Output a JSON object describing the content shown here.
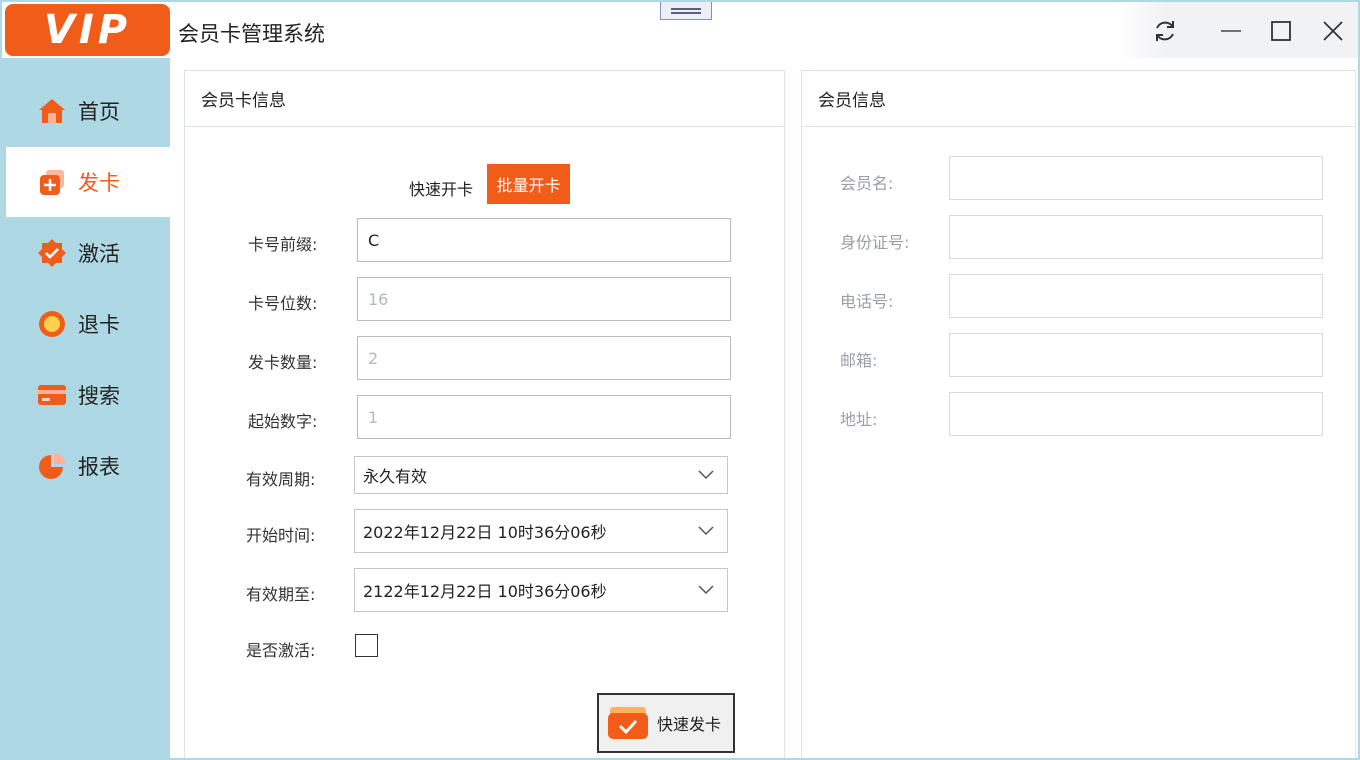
{
  "logo_text": "VIP",
  "app_title": "会员卡管理系统",
  "window_controls": {
    "refresh_icon": "refresh-icon",
    "minimize_icon": "minimize-icon",
    "maximize_icon": "maximize-icon",
    "close_icon": "close-icon"
  },
  "sidebar": {
    "items": [
      {
        "label": "首页",
        "icon": "home-icon"
      },
      {
        "label": "发卡",
        "icon": "add-card-icon",
        "active": true
      },
      {
        "label": "激活",
        "icon": "check-badge-icon"
      },
      {
        "label": "退卡",
        "icon": "return-icon"
      },
      {
        "label": "搜索",
        "icon": "card-search-icon"
      },
      {
        "label": "报表",
        "icon": "pie-chart-icon"
      }
    ]
  },
  "card_panel": {
    "title": "会员卡信息",
    "tabs": {
      "quick": "快速开卡",
      "batch": "批量开卡"
    },
    "fields": {
      "prefix_label": "卡号前缀:",
      "prefix_value": "C",
      "digits_label": "卡号位数:",
      "digits_placeholder": "16",
      "count_label": "发卡数量:",
      "count_placeholder": "2",
      "start_label": "起始数字:",
      "start_placeholder": "1",
      "period_label": "有效周期:",
      "period_value": "永久有效",
      "start_time_label": "开始时间:",
      "start_time_value": "2022年12月22日 10时36分06秒",
      "expire_label": "有效期至:",
      "expire_value": "2122年12月22日 10时36分06秒",
      "activate_label": "是否激活:",
      "activate_checked": false
    },
    "issue_button": "快速发卡"
  },
  "member_panel": {
    "title": "会员信息",
    "fields": [
      {
        "label": "会员名:",
        "value": ""
      },
      {
        "label": "身份证号:",
        "value": ""
      },
      {
        "label": "电话号:",
        "value": ""
      },
      {
        "label": "邮箱:",
        "value": ""
      },
      {
        "label": "地址:",
        "value": ""
      }
    ]
  },
  "colors": {
    "accent": "#f25c19",
    "sidebar_bg": "#aed8e3"
  }
}
